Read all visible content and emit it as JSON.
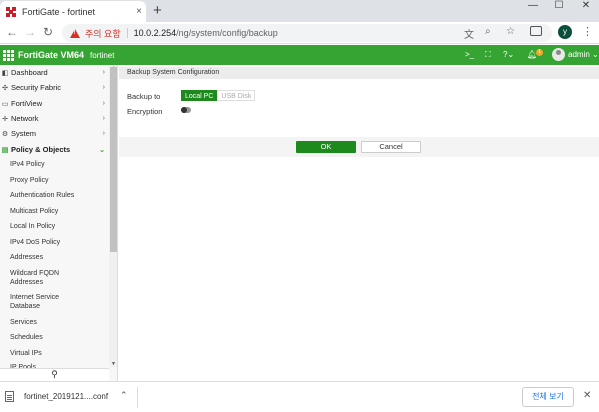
{
  "browser": {
    "tab_title": "FortiGate - fortinet",
    "close_glyph": "×",
    "new_tab": "+",
    "win_minimize": "—",
    "win_maximize": "☐",
    "win_close": "✕",
    "security_text": "주의 요함",
    "url_host": "10.0.2.254",
    "url_path": "/ng/system/config/backup",
    "profile_initial": "y"
  },
  "header": {
    "product": "FortiGate VM64",
    "hostname": "fortinet",
    "notification_count": "1",
    "user": "admin"
  },
  "sidebar": {
    "items": [
      {
        "label": "Dashboard",
        "icon": "dashboard-icon"
      },
      {
        "label": "Security Fabric",
        "icon": "security-fabric-icon"
      },
      {
        "label": "FortiView",
        "icon": "fortiview-icon"
      },
      {
        "label": "Network",
        "icon": "network-icon"
      },
      {
        "label": "System",
        "icon": "gear-icon"
      },
      {
        "label": "Policy & Objects",
        "icon": "policy-icon"
      }
    ],
    "sub_items": [
      "IPv4 Policy",
      "Proxy Policy",
      "Authentication Rules",
      "Multicast Policy",
      "Local In Policy",
      "IPv4 DoS Policy",
      "Addresses",
      "Wildcard FQDN Addresses",
      "Internet Service Database",
      "Services",
      "Schedules",
      "Virtual IPs",
      "IP Pools"
    ]
  },
  "main": {
    "section_title": "Backup System Configuration",
    "backup_to_label": "Backup to",
    "backup_options": [
      "Local PC",
      "USB Disk"
    ],
    "selected_option": "Local PC",
    "encryption_label": "Encryption",
    "encryption_enabled": false,
    "ok_label": "OK",
    "cancel_label": "Cancel"
  },
  "downloads": {
    "file_name": "fortinet_2019121....conf",
    "show_all_label": "전체 보기"
  }
}
